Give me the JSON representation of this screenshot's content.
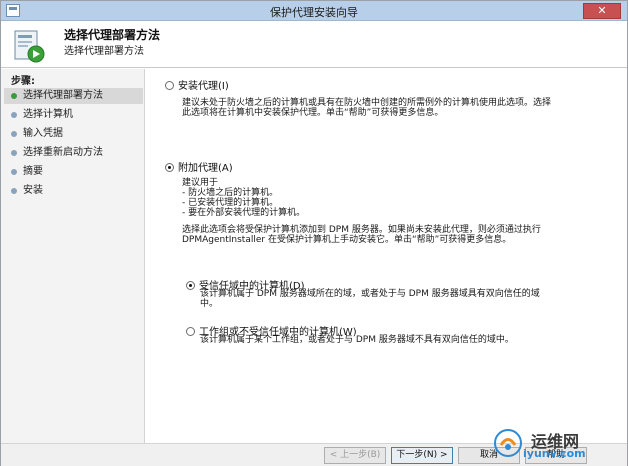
{
  "window": {
    "title": "保护代理安装向导",
    "close_glyph": "✕"
  },
  "header": {
    "heading": "选择代理部署方法",
    "subheading": "选择代理部署方法"
  },
  "sidebar": {
    "title": "步骤:",
    "items": [
      {
        "label": "选择代理部署方法",
        "active": true
      },
      {
        "label": "选择计算机",
        "active": false
      },
      {
        "label": "输入凭据",
        "active": false
      },
      {
        "label": "选择重新启动方法",
        "active": false
      },
      {
        "label": "摘要",
        "active": false
      },
      {
        "label": "安装",
        "active": false
      }
    ]
  },
  "options": {
    "install_agent": {
      "label": "安装代理(I)",
      "checked": false,
      "description": "建议未处于防火墙之后的计算机或具有在防火墙中创建的所需例外的计算机使用此选项。选择\n此选项将在计算机中安装保护代理。单击“帮助”可获得更多信息。"
    },
    "attach_agent": {
      "label": "附加代理(A)",
      "checked": true,
      "description_list": "建议用于\n- 防火墙之后的计算机。\n- 已安装代理的计算机。\n- 要在外部安装代理的计算机。",
      "description_note": "选择此选项会将受保护计算机添加到 DPM 服务器。如果尚未安装此代理，则必须通过执行\nDPMAgentInstaller 在受保护计算机上手动安装它。单击“帮助”可获得更多信息。"
    },
    "trusted_domain": {
      "label": "受信任域中的计算机(D)",
      "checked": true,
      "description": "该计算机属于 DPM 服务器域所在的域，或者处于与 DPM 服务器域具有双向信任的域\n中。"
    },
    "untrusted_domain": {
      "label": "工作组或不受信任域中的计算机(W)",
      "checked": false,
      "description": "该计算机属于某个工作组，或者处于与 DPM 服务器域不具有双向信任的域中。"
    }
  },
  "footer": {
    "back_label": "< 上一步(B)",
    "next_label": "下一步(N) >",
    "cancel_label": "取消",
    "help_label": "帮助"
  },
  "watermark": {
    "text": "运维网",
    "url": "iyunv.com"
  },
  "colors": {
    "titlebar": "#b7cfe8",
    "close": "#c75050",
    "active_step_dot": "#3b9a3b",
    "watermark_url": "#2d8bd6"
  }
}
